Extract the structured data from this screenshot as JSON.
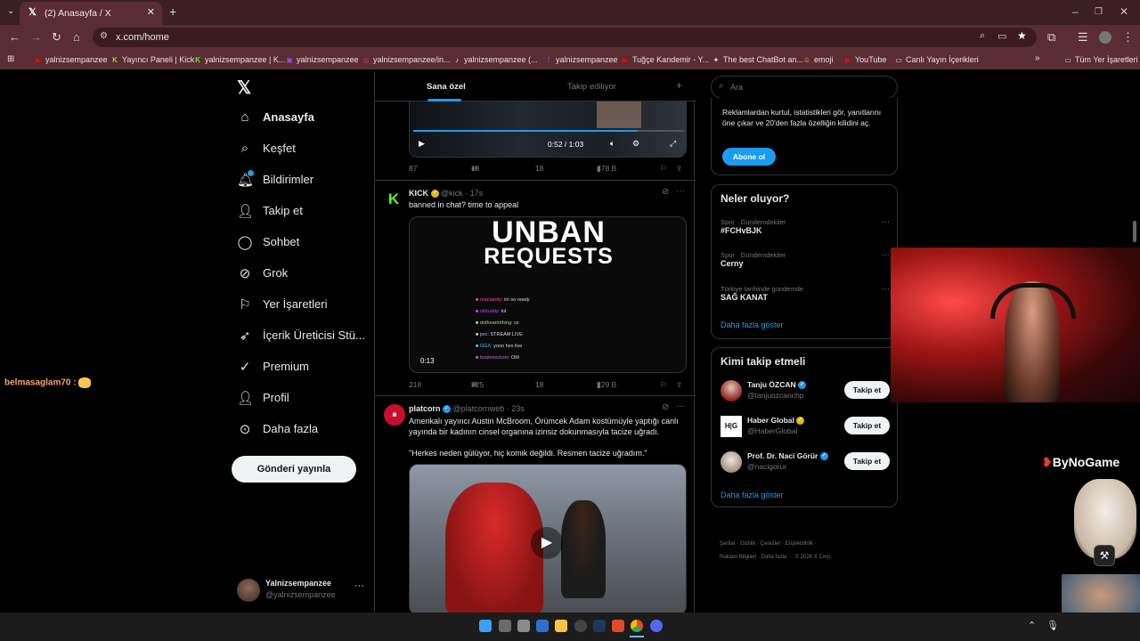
{
  "browser": {
    "tab_title": "(2) Anasayfa / X",
    "url": "x.com/home",
    "bookmarks": [
      {
        "label": "yalnizsempanzee",
        "icon": "youtube-icon",
        "color": "#ff0000"
      },
      {
        "label": "Yayıncı Paneli | Kick",
        "icon": "kick-icon",
        "color": "#53fc18"
      },
      {
        "label": "yalnizsempanzee | K...",
        "icon": "kick-icon",
        "color": "#53fc18"
      },
      {
        "label": "yalnizsempanzee",
        "icon": "twitch-icon",
        "color": "#9146ff"
      },
      {
        "label": "yalnizsempanzee/in...",
        "icon": "instagram-icon",
        "color": "#e1306c"
      },
      {
        "label": "yalnizsempanzee (...",
        "icon": "tiktok-icon",
        "color": "#ffffff"
      },
      {
        "label": "yalnizsempanzee",
        "icon": "facebook-icon",
        "color": "#1877f2"
      },
      {
        "label": "Tuğçe Kandemir - Y...",
        "icon": "youtube-icon",
        "color": "#ff0000"
      },
      {
        "label": "The best ChatBot an...",
        "icon": "chatbot-icon",
        "color": "#ffffff"
      },
      {
        "label": "emoji",
        "icon": "emoji-icon",
        "color": "#f7c948"
      },
      {
        "label": "YouTube",
        "icon": "youtube-icon",
        "color": "#ff0000"
      },
      {
        "label": "Canlı Yayın İçerikleri",
        "icon": "folder-icon",
        "color": "#dddddd"
      }
    ],
    "all_bookmarks": "Tüm Yer İşaretleri"
  },
  "nav": {
    "items": [
      {
        "label": "Anasayfa",
        "icon": "home-icon"
      },
      {
        "label": "Keşfet",
        "icon": "search-icon"
      },
      {
        "label": "Bildirimler",
        "icon": "bell-icon"
      },
      {
        "label": "Takip et",
        "icon": "add-person-icon"
      },
      {
        "label": "Sohbet",
        "icon": "chat-icon"
      },
      {
        "label": "Grok",
        "icon": "grok-icon"
      },
      {
        "label": "Yer İşaretleri",
        "icon": "bookmark-icon"
      },
      {
        "label": "İçerik Üreticisi Stü...",
        "icon": "rocket-icon"
      },
      {
        "label": "Premium",
        "icon": "premium-icon"
      },
      {
        "label": "Profil",
        "icon": "person-icon"
      },
      {
        "label": "Daha fazla",
        "icon": "more-circle-icon"
      }
    ],
    "post_button": "Gönderi yayınla",
    "account": {
      "name": "Yalnizsempanzee",
      "handle": "@yalnizsempanzee"
    }
  },
  "feed": {
    "tabs": [
      "Sana özel",
      "Takip ediliyor"
    ],
    "tweet1": {
      "video_time": "0:52 / 1:03",
      "stats": {
        "replies": "87",
        "reposts": "18",
        "likes": "18",
        "views": "478 B"
      }
    },
    "tweet2": {
      "author": "KICK",
      "handle": "@kick · 17s",
      "text": "banned in chat? time to appeal",
      "media_title_1": "UNBAN",
      "media_title_2": "REQUESTS",
      "chat_lines": [
        {
          "user": "reactandy:",
          "msg": "im so ready",
          "color": "#f04ea5"
        },
        {
          "user": "okbuddy:",
          "msg": "lol",
          "color": "#e040fb"
        },
        {
          "user": "dothearmthing:",
          "msg": "cx",
          "color": "#a8e05f"
        },
        {
          "user": "pvc:",
          "msg": "STREAM LIVE",
          "color": "#c9a0ff"
        },
        {
          "user": "GGX:",
          "msg": "yooo hes live",
          "color": "#4fc3f7"
        },
        {
          "user": "boatwreckstv:",
          "msg": "OM",
          "color": "#ba68c8"
        }
      ],
      "video_time": "0:13",
      "stats": {
        "replies": "218",
        "reposts": "325",
        "likes": "18",
        "views": "229 B"
      }
    },
    "tweet3": {
      "author": "platcorn",
      "handle": "@platcornweb · 23s",
      "text1": "Amerikalı yayıncı Austin McBroom, Örümcek Adam kostümüyle yaptığı canlı yayında bir kadının cinsel organına izinsiz dokunmasıyla tacize uğradı.",
      "text2": "\"Herkes neden gülüyor, hiç komik değildi. Resmen tacize uğradım.\""
    }
  },
  "right": {
    "search_placeholder": "Ara",
    "premium_text": "Reklamlardan kurtul, istatistikleri gör, yanıtlarını öne çıkar ve 20'den fazla özelliğin kilidini aç.",
    "premium_button": "Abone ol",
    "trends_title": "Neler oluyor?",
    "trends": [
      {
        "meta": "Spor · Gündemdekiler",
        "name": "#FCHvBJK"
      },
      {
        "meta": "Spor · Gündemdekiler",
        "name": "Cerny"
      },
      {
        "meta": "Türkiye tarihinde gündemde",
        "name": "SAĞ KANAT"
      }
    ],
    "show_more": "Daha fazla göster",
    "follow_title": "Kimi takip etmeli",
    "follow": [
      {
        "name": "Tanju ÖZCAN",
        "handle": "@tanjuozcanchp",
        "button": "Takip et",
        "badge": "blue"
      },
      {
        "name": "Haber Global",
        "handle": "@HaberGlobal",
        "button": "Takip et",
        "badge": "gold"
      },
      {
        "name": "Prof. Dr. Naci Görür",
        "handle": "@nacigorur",
        "button": "Takip et",
        "badge": "blue"
      }
    ],
    "show_more_2": "Daha fazla göster",
    "footer_1": "Şartlar · Gizlilik · Çerezler · Erişilebilirlik ·",
    "footer_2": "Reklam Bilgileri · Daha fazla ··· © 2026 X Corp."
  },
  "overlay": {
    "chat_user": "belmasaglam70 :",
    "brand": "ByNoGame"
  }
}
